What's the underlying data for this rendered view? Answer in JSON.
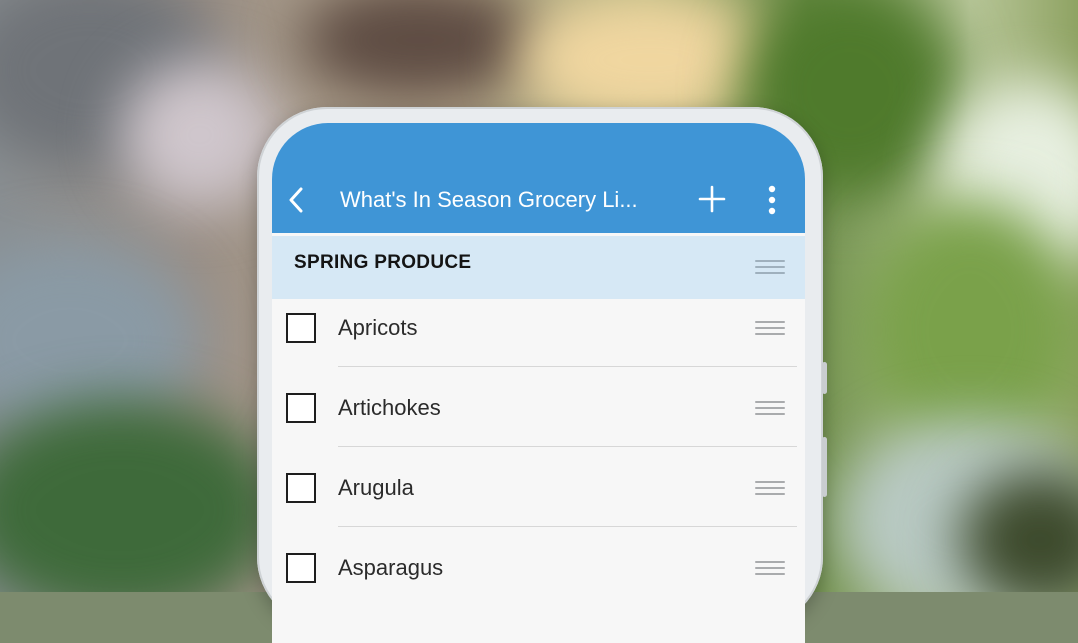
{
  "appbar": {
    "title": "What's In Season Grocery Li...",
    "back_icon": "chevron-left-icon",
    "add_icon": "plus-icon",
    "more_icon": "more-vertical-icon",
    "color": "#3f95d6"
  },
  "section": {
    "title": "SPRING PRODUCE",
    "color": "#d6e8f5"
  },
  "items": [
    {
      "label": "Apricots",
      "checked": false
    },
    {
      "label": "Artichokes",
      "checked": false
    },
    {
      "label": "Arugula",
      "checked": false
    },
    {
      "label": "Asparagus",
      "checked": false
    }
  ]
}
